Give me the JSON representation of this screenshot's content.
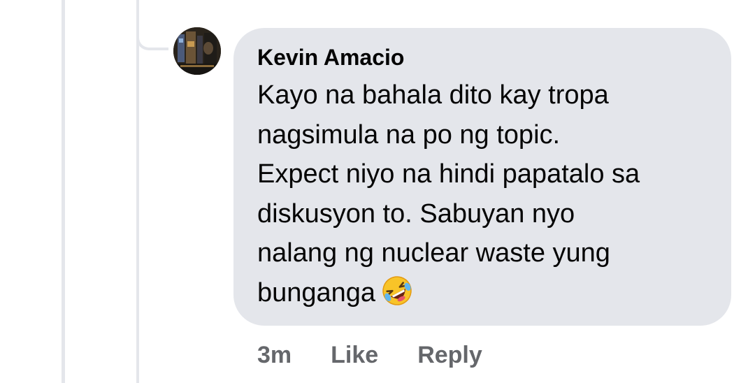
{
  "comment": {
    "author": "Kevin Amacio",
    "text_lines": [
      "Kayo na bahala dito kay tropa",
      "nagsimula na po ng topic.",
      "Expect niyo na hindi papatalo sa",
      "diskusyon to. Sabuyan nyo",
      "nalang ng nuclear waste yung",
      "bunganga"
    ],
    "emoji": "rolling-on-the-floor-laughing-icon"
  },
  "actions": {
    "time": "3m",
    "like_label": "Like",
    "reply_label": "Reply"
  },
  "colors": {
    "bubble": "#e4e6eb",
    "text": "#050505",
    "meta": "#65676b"
  }
}
